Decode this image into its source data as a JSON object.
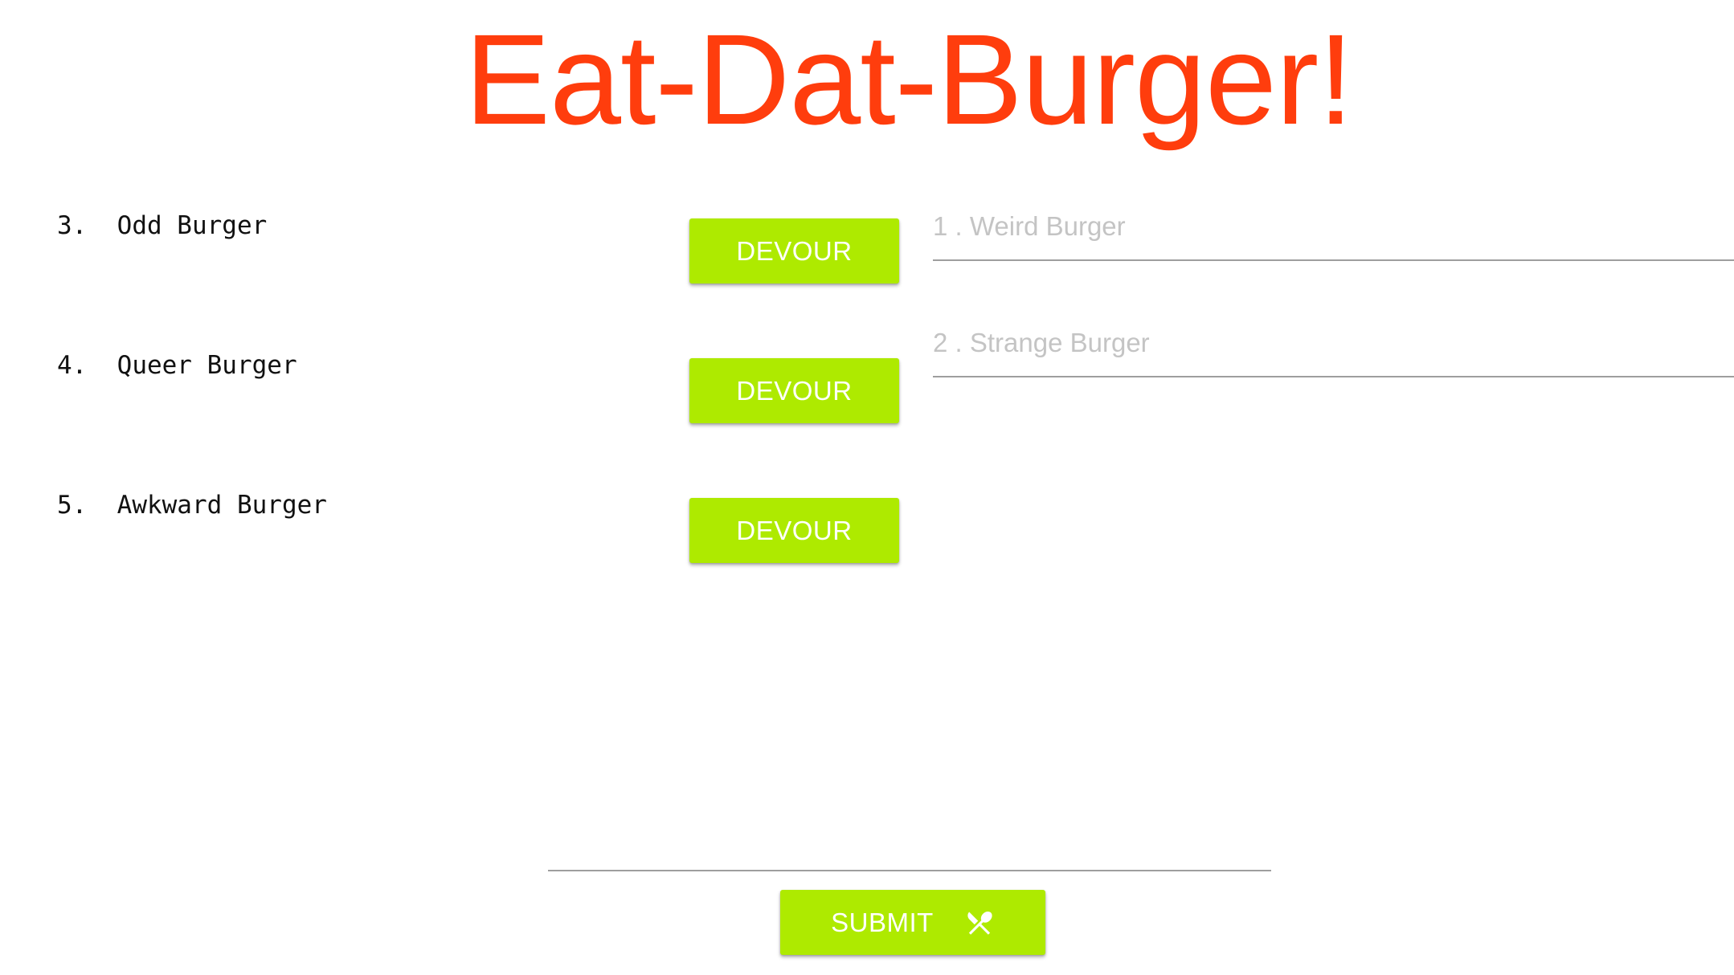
{
  "header": {
    "title": "Eat-Dat-Burger!"
  },
  "uneaten": [
    {
      "label": "3.  Odd Burger",
      "button_label": "DEVOUR"
    },
    {
      "label": "4.  Queer Burger",
      "button_label": "DEVOUR"
    },
    {
      "label": "5.  Awkward Burger",
      "button_label": "DEVOUR"
    }
  ],
  "eaten": [
    {
      "label": "1 . Weird Burger"
    },
    {
      "label": "2 . Strange Burger"
    }
  ],
  "form": {
    "input_value": "",
    "input_placeholder": "",
    "submit_label": "SUBMIT",
    "submit_icon": "utensils-crossed-icon"
  },
  "colors": {
    "title": "#ff3d0d",
    "button": "#aeea00",
    "button_text": "#ffffff",
    "eaten_text": "#c4c4c4"
  }
}
